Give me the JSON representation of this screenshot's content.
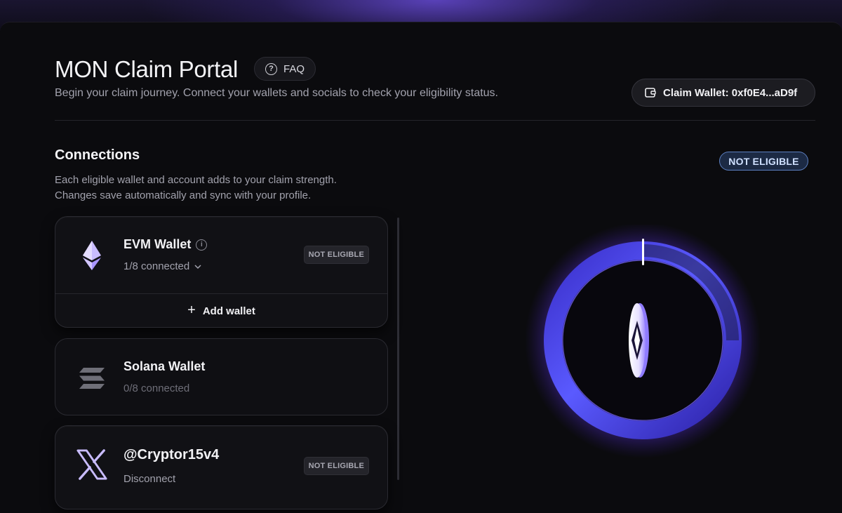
{
  "header": {
    "title": "MON Claim Portal",
    "faq_label": "FAQ",
    "subtitle": "Begin your claim journey. Connect your wallets and socials to check your eligibility status.",
    "claim_wallet_label": "Claim Wallet: 0xf0E4...aD9f"
  },
  "connections": {
    "title": "Connections",
    "description_line1": "Each eligible wallet and account adds to your claim strength.",
    "description_line2": "Changes save automatically and sync with your profile.",
    "status": "NOT ELIGIBLE",
    "cards": [
      {
        "name": "EVM Wallet",
        "icon": "ethereum-icon",
        "sub": "1/8 connected",
        "badge": "NOT ELIGIBLE",
        "action": "Add wallet"
      },
      {
        "name": "Solana Wallet",
        "icon": "solana-icon",
        "sub": "0/8 connected"
      },
      {
        "name": "@Cryptor15v4",
        "icon": "x-logo-icon",
        "sub": "Disconnect",
        "badge": "NOT ELIGIBLE"
      }
    ]
  },
  "colors": {
    "accent": "#7b5cff",
    "ring": "#5a4dff",
    "status_border": "#5c7fc0"
  }
}
